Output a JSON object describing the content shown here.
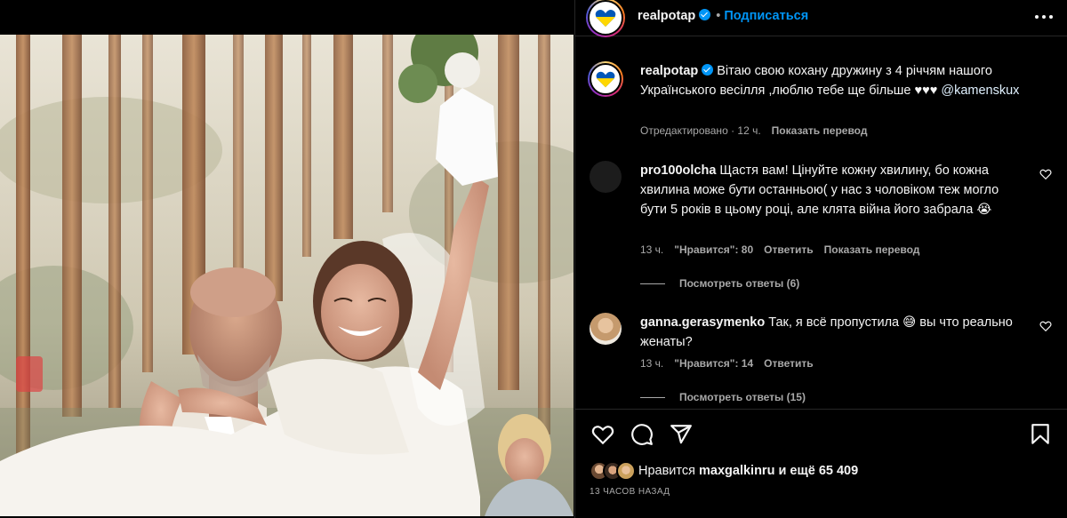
{
  "post": {
    "author": "realpotap",
    "follow_label": "Подписаться",
    "dot": "•",
    "caption_author": "realpotap",
    "caption_text": "Вітаю свою кохану дружину з 4 річчям нашого Українського весілля ,люблю тебе ще більше ♥♥♥",
    "caption_mention": "@kamenskux",
    "caption_meta_time": "Отредактировано · 12 ч.",
    "caption_translate": "Показать перевод"
  },
  "comments": [
    {
      "username": "pro100olcha",
      "text": "Щастя вам! Цінуйте кожну хвилину, бо кожна хвилина може бути останньою( у нас з чоловіком теж могло бути 5 років в цьому році, але клята війна його забрала 😭",
      "time": "13 ч.",
      "likes": "\"Нравится\": 80",
      "reply": "Ответить",
      "translate": "Показать перевод",
      "view_replies": "Посмотреть ответы (6)"
    },
    {
      "username": "ganna.gerasymenko",
      "text": "Так, я всё пропустила 😅 вы что реально женаты?",
      "time": "13 ч.",
      "likes": "\"Нравится\": 14",
      "reply": "Ответить",
      "view_replies": "Посмотреть ответы (15)"
    }
  ],
  "footer": {
    "likes_prefix": "Нравится",
    "likes_user": "maxgalkinru",
    "likes_middle": "и ещё",
    "likes_count": "65 409",
    "time_ago": "13 ЧАСОВ НАЗАД"
  },
  "colors": {
    "accent": "#0095f6",
    "background": "#000000",
    "text": "#f5f5f5",
    "muted": "#a8a8a8",
    "divider": "#262626"
  },
  "icons": [
    "more-icon",
    "verified-icon",
    "heart-icon",
    "comment-icon",
    "share-icon",
    "bookmark-icon"
  ]
}
